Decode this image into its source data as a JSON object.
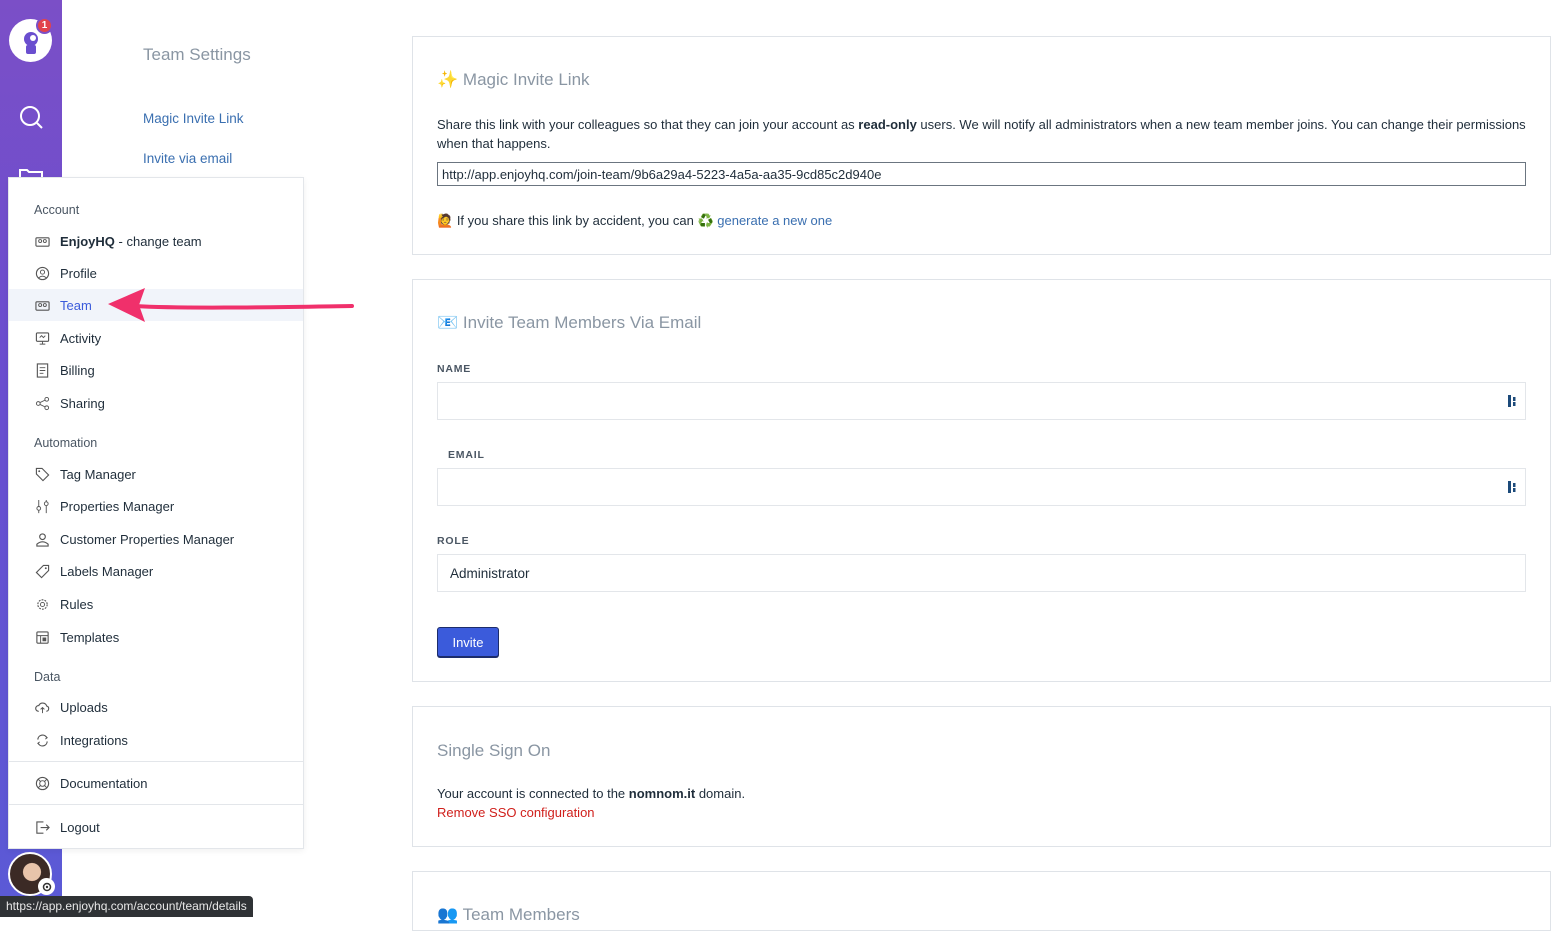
{
  "rail": {
    "notification_count": "1"
  },
  "subnav": {
    "title": "Team Settings",
    "links": [
      "Magic Invite Link",
      "Invite via email"
    ]
  },
  "menu": {
    "sections": {
      "account": "Account",
      "automation": "Automation",
      "data": "Data"
    },
    "items": {
      "team_switch_bold": "EnjoyHQ",
      "team_switch_rest": " - change team",
      "profile": "Profile",
      "team": "Team",
      "activity": "Activity",
      "billing": "Billing",
      "sharing": "Sharing",
      "tag_manager": "Tag Manager",
      "properties_manager": "Properties Manager",
      "customer_properties_manager": "Customer Properties Manager",
      "labels_manager": "Labels Manager",
      "rules": "Rules",
      "templates": "Templates",
      "uploads": "Uploads",
      "integrations": "Integrations",
      "documentation": "Documentation",
      "logout": "Logout"
    }
  },
  "magic_link": {
    "emoji": "✨",
    "title": "Magic Invite Link",
    "desc_1": "Share this link with your colleagues so that they can join your account as ",
    "desc_bold": "read-only",
    "desc_2": " users. We will notify all administrators when a new team member joins. You can change their permissions when that happens.",
    "url": "http://app.enjoyhq.com/join-team/9b6a29a4-5223-4a5a-aa35-9cd85c2d940e",
    "accident_emoji": "🙋",
    "accident_text": "If you share this link by accident, you can ",
    "recycle_emoji": "♻️",
    "regenerate_link": "generate a new one"
  },
  "invite_email": {
    "emoji": "📧",
    "title": "Invite Team Members Via Email",
    "name_label": "NAME",
    "email_label": "EMAIL",
    "role_label": "ROLE",
    "role_value": "Administrator",
    "invite_button": "Invite"
  },
  "sso": {
    "title": "Single Sign On",
    "text_1": "Your account is connected to the ",
    "domain": "nomnom.it",
    "text_2": " domain.",
    "remove_link": "Remove SSO configuration"
  },
  "team_members": {
    "emoji": "👥",
    "title": "Team Members"
  },
  "status_bar": {
    "url": "https://app.enjoyhq.com/account/team/details"
  },
  "colors": {
    "accent": "#3b5bdb",
    "link": "#3a6fb0",
    "danger": "#d0201c",
    "arrow": "#f0306b"
  }
}
